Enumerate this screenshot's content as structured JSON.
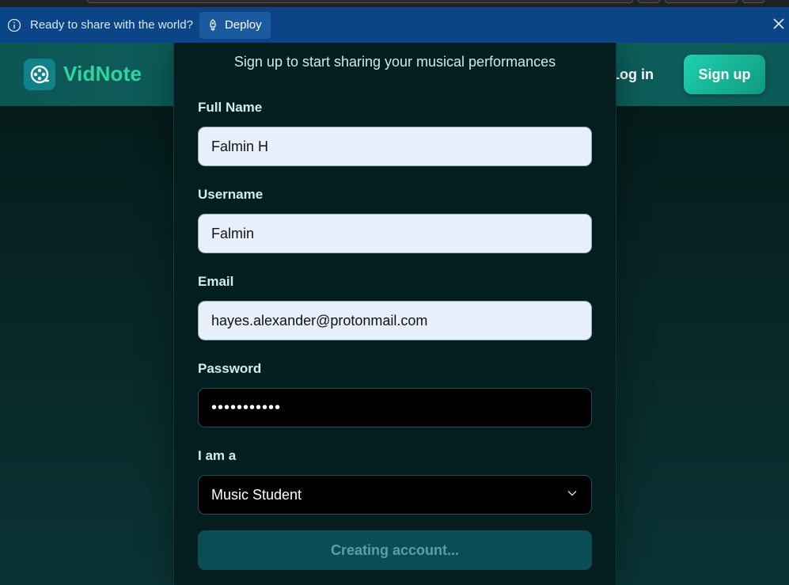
{
  "banner": {
    "text": "Ready to share with the world?",
    "deploy_label": "Deploy"
  },
  "nav": {
    "brand": "VidNote",
    "login_label": "Log in",
    "signup_label": "Sign up"
  },
  "form": {
    "subtitle": "Sign up to start sharing your musical performances",
    "full_name": {
      "label": "Full Name",
      "value": "Falmin H"
    },
    "username": {
      "label": "Username",
      "value": "Falmin"
    },
    "email": {
      "label": "Email",
      "value": "hayes.alexander@protonmail.com"
    },
    "password": {
      "label": "Password",
      "masked_value": "•••••••••••"
    },
    "role": {
      "label": "I am a",
      "selected": "Music Student"
    },
    "submit_label": "Creating account..."
  },
  "colors": {
    "banner_bg": "#0b4587",
    "brand": "#2bd6a0",
    "accent": "#1fd0b0",
    "submit_disabled_bg": "#0a4d55"
  }
}
